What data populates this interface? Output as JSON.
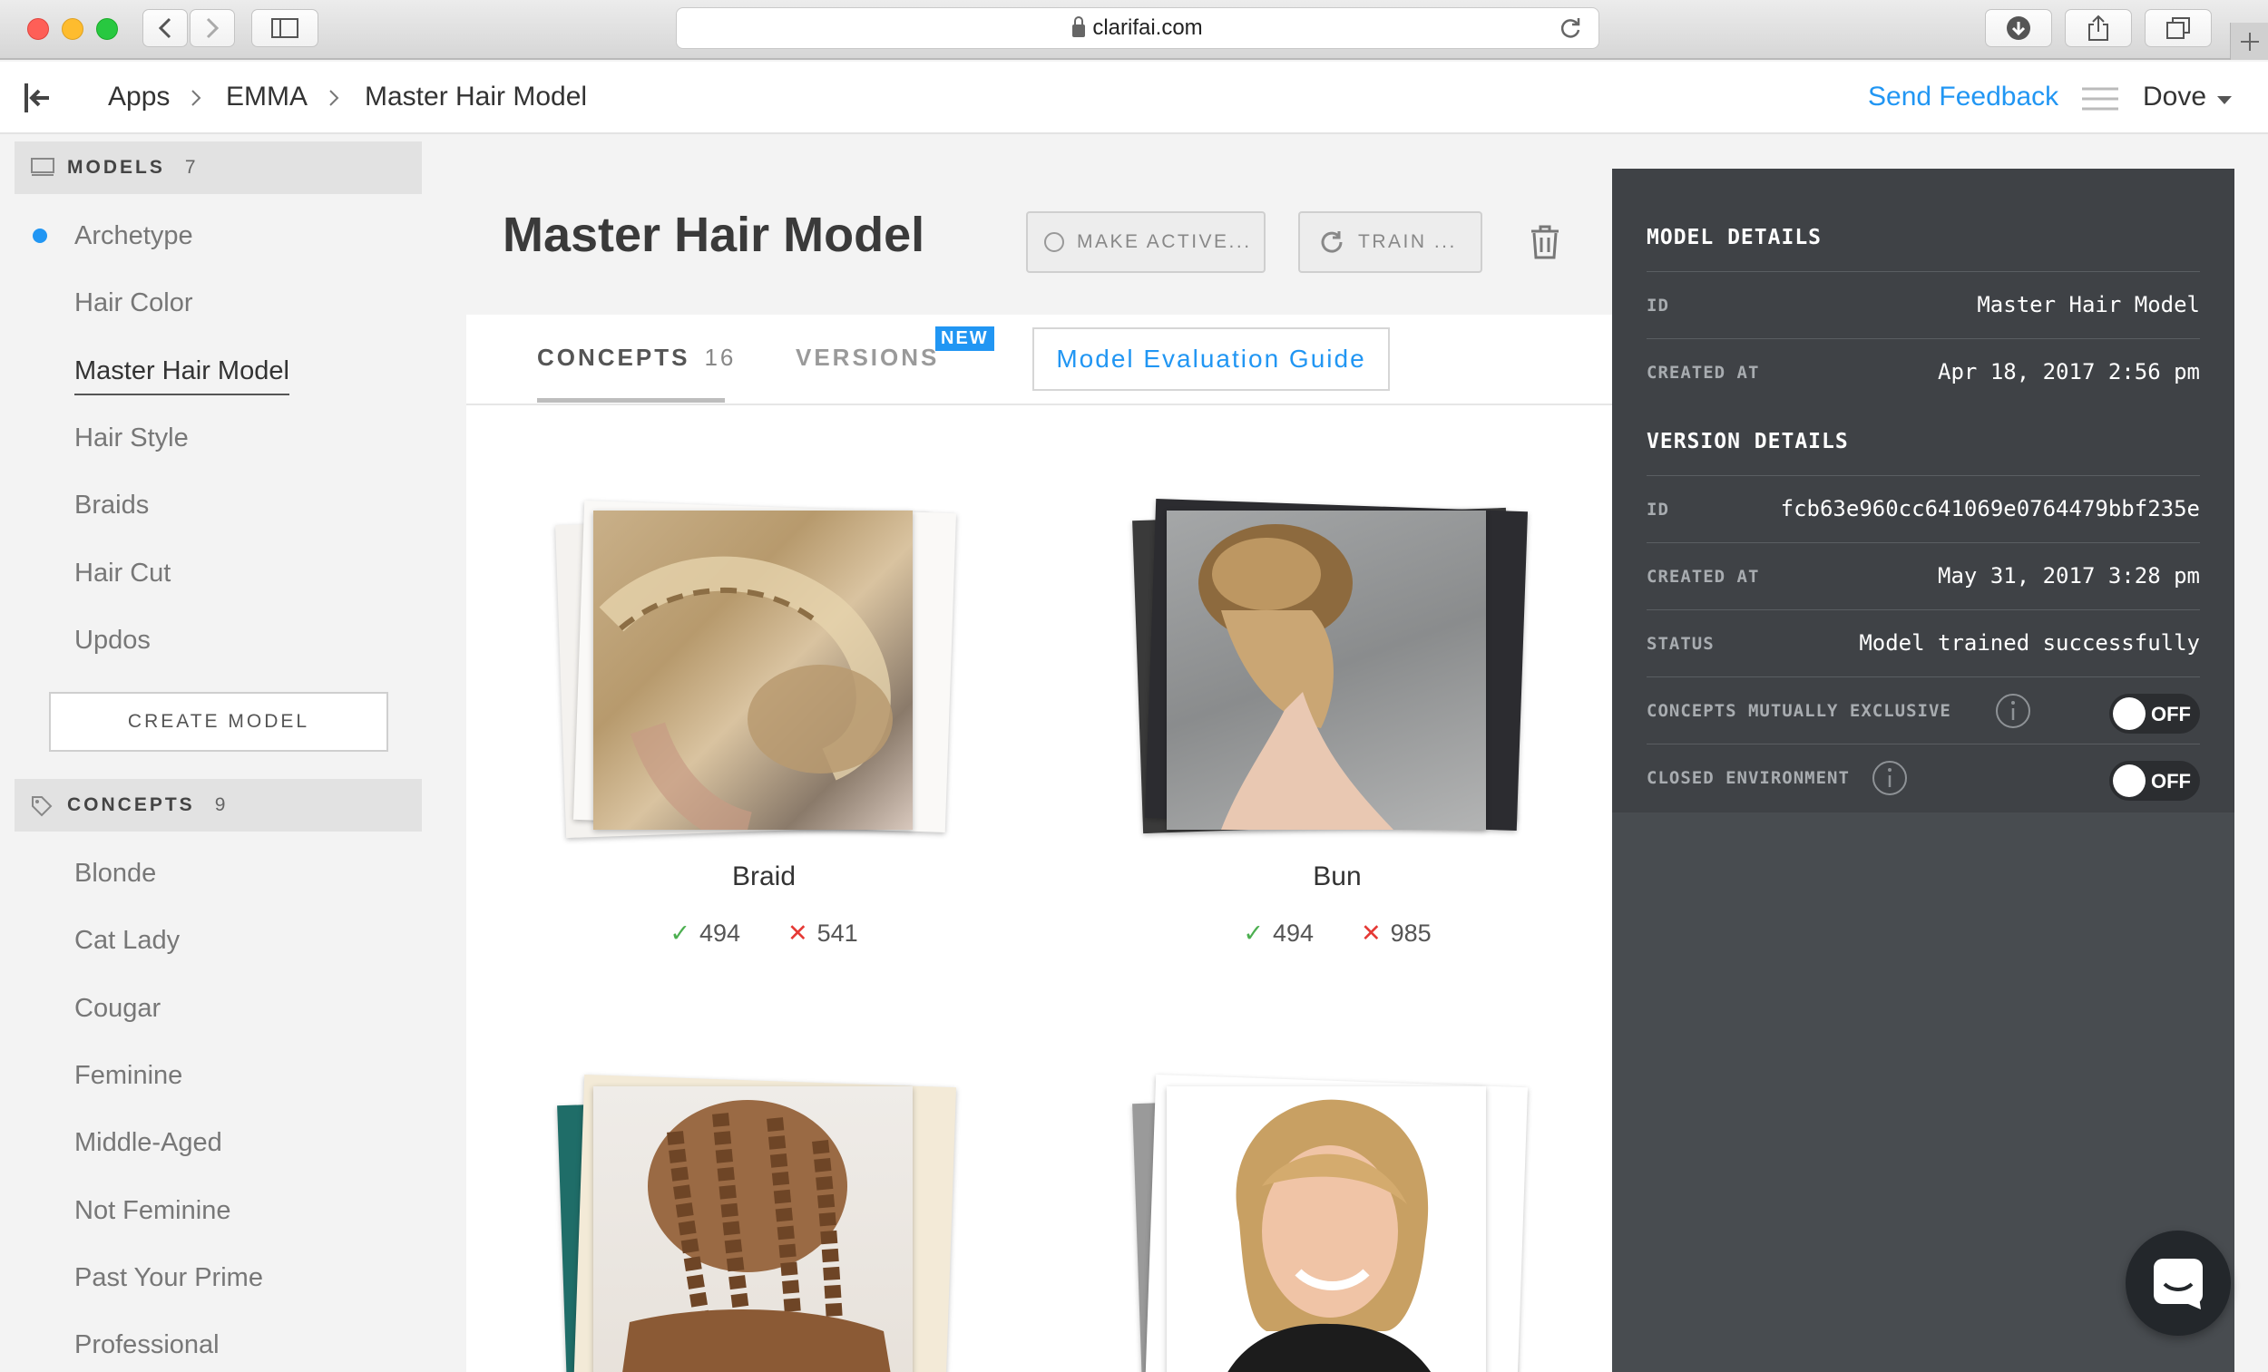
{
  "browser": {
    "url": "clarifai.com"
  },
  "breadcrumb": {
    "apps": "Apps",
    "app": "EMMA",
    "model": "Master Hair Model"
  },
  "header": {
    "feedback": "Send Feedback",
    "user": "Dove"
  },
  "sidebar": {
    "models_label": "MODELS",
    "models_count": "7",
    "models": [
      "Archetype",
      "Hair Color",
      "Master Hair Model",
      "Hair Style",
      "Braids",
      "Hair Cut",
      "Updos"
    ],
    "create_model": "CREATE MODEL",
    "concepts_label": "CONCEPTS",
    "concepts_count": "9",
    "concepts": [
      "Blonde",
      "Cat Lady",
      "Cougar",
      "Feminine",
      "Middle-Aged",
      "Not Feminine",
      "Past Your Prime",
      "Professional"
    ]
  },
  "main": {
    "title": "Master Hair Model",
    "make_active": "MAKE ACTIVE...",
    "train": "TRAIN ...",
    "tabs": {
      "concepts": "CONCEPTS",
      "concepts_count": "16",
      "versions": "VERSIONS",
      "new_badge": "NEW"
    },
    "guide": "Model Evaluation Guide",
    "concepts": [
      {
        "name": "Braid",
        "positive": "494",
        "negative": "541"
      },
      {
        "name": "Bun",
        "positive": "494",
        "negative": "985"
      }
    ]
  },
  "details": {
    "model_heading": "MODEL DETAILS",
    "model": {
      "id_label": "ID",
      "id": "Master Hair Model",
      "created_label": "CREATED AT",
      "created": "Apr 18, 2017 2:56 pm"
    },
    "version_heading": "VERSION DETAILS",
    "version": {
      "id_label": "ID",
      "id": "fcb63e960cc641069e0764479bbf235e",
      "created_label": "CREATED AT",
      "created": "May 31, 2017 3:28 pm",
      "status_label": "STATUS",
      "status": "Model trained successfully",
      "exclusive_label": "CONCEPTS MUTUALLY EXCLUSIVE",
      "exclusive": "OFF",
      "closed_label": "CLOSED ENVIRONMENT",
      "closed": "OFF"
    }
  },
  "colors": {
    "accent": "#2196f3",
    "panel": "#484c50",
    "positive": "#4caf50",
    "negative": "#e53935"
  }
}
